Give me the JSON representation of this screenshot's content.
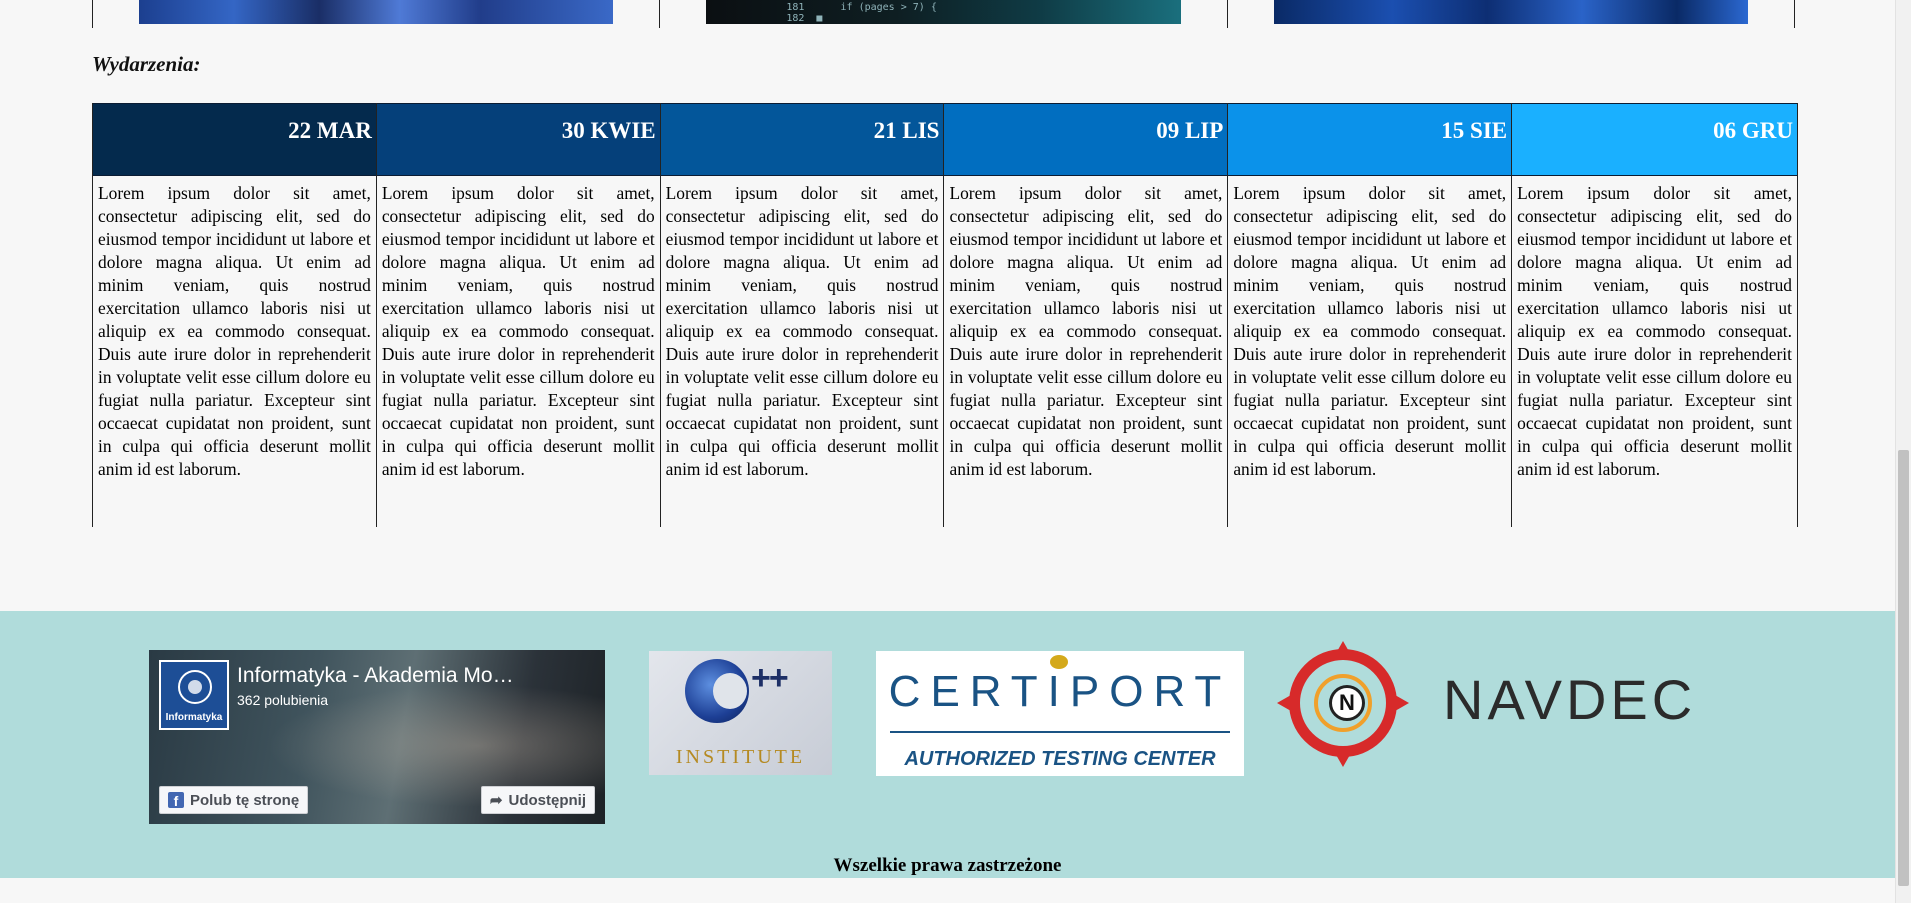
{
  "events": {
    "title": "Wydarzenia:",
    "items": [
      {
        "date": "22 MAR",
        "color": "#042a4d",
        "text": "Lorem ipsum dolor sit amet, consectetur adipiscing elit, sed do eiusmod tempor incididunt ut labore et dolore magna aliqua. Ut enim ad minim veniam, quis nostrud exercitation ullamco laboris nisi ut aliquip ex ea commodo consequat. Duis aute irure dolor in reprehenderit in voluptate velit esse cillum dolore eu fugiat nulla pariatur. Excepteur sint occaecat cupidatat non proident, sunt in culpa qui officia deserunt mollit anim id est laborum."
      },
      {
        "date": "30 KWIE",
        "color": "#05407a",
        "text": "Lorem ipsum dolor sit amet, consectetur adipiscing elit, sed do eiusmod tempor incididunt ut labore et dolore magna aliqua. Ut enim ad minim veniam, quis nostrud exercitation ullamco laboris nisi ut aliquip ex ea commodo consequat. Duis aute irure dolor in reprehenderit in voluptate velit esse cillum dolore eu fugiat nulla pariatur. Excepteur sint occaecat cupidatat non proident, sunt in culpa qui officia deserunt mollit anim id est laborum."
      },
      {
        "date": "21 LIS",
        "color": "#03569a",
        "text": "Lorem ipsum dolor sit amet, consectetur adipiscing elit, sed do eiusmod tempor incididunt ut labore et dolore magna aliqua. Ut enim ad minim veniam, quis nostrud exercitation ullamco laboris nisi ut aliquip ex ea commodo consequat. Duis aute irure dolor in reprehenderit in voluptate velit esse cillum dolore eu fugiat nulla pariatur. Excepteur sint occaecat cupidatat non proident, sunt in culpa qui officia deserunt mollit anim id est laborum."
      },
      {
        "date": "09 LIP",
        "color": "#016ec0",
        "text": "Lorem ipsum dolor sit amet, consectetur adipiscing elit, sed do eiusmod tempor incididunt ut labore et dolore magna aliqua. Ut enim ad minim veniam, quis nostrud exercitation ullamco laboris nisi ut aliquip ex ea commodo consequat. Duis aute irure dolor in reprehenderit in voluptate velit esse cillum dolore eu fugiat nulla pariatur. Excepteur sint occaecat cupidatat non proident, sunt in culpa qui officia deserunt mollit anim id est laborum."
      },
      {
        "date": "15 SIE",
        "color": "#0b92ea",
        "text": "Lorem ipsum dolor sit amet, consectetur adipiscing elit, sed do eiusmod tempor incididunt ut labore et dolore magna aliqua. Ut enim ad minim veniam, quis nostrud exercitation ullamco laboris nisi ut aliquip ex ea commodo consequat. Duis aute irure dolor in reprehenderit in voluptate velit esse cillum dolore eu fugiat nulla pariatur. Excepteur sint occaecat cupidatat non proident, sunt in culpa qui officia deserunt mollit anim id est laborum."
      },
      {
        "date": "06 GRU",
        "color": "#1ab0ff",
        "text": "Lorem ipsum dolor sit amet, consectetur adipiscing elit, sed do eiusmod tempor incididunt ut labore et dolore magna aliqua. Ut enim ad minim veniam, quis nostrud exercitation ullamco laboris nisi ut aliquip ex ea commodo consequat. Duis aute irure dolor in reprehenderit in voluptate velit esse cillum dolore eu fugiat nulla pariatur. Excepteur sint occaecat cupidatat non proident, sunt in culpa qui officia deserunt mollit anim id est laborum."
      }
    ]
  },
  "top_images": {
    "code_snippet": "181      if (pages > 7) {\n182  ■"
  },
  "footer": {
    "background": "#b0dcdb",
    "facebook": {
      "page_name": "Informatyka - Akademia Mo…",
      "likes": "362 polubienia",
      "logo_label": "Informatyka",
      "like_button": "Polub tę stronę",
      "share_button": "Udostępnij",
      "fb_icon": "facebook-f-icon",
      "share_icon": "share-arrow-icon"
    },
    "cpp_logo": {
      "plus": "++",
      "label": "INSTITUTE"
    },
    "certiport_logo": {
      "name": "CERTIPORT",
      "subtitle": "AUTHORIZED TESTING CENTER"
    },
    "navdec_logo": {
      "letter": "N",
      "name": "NAVDEC"
    },
    "copyright": "Wszelkie prawa zastrzeżone"
  }
}
